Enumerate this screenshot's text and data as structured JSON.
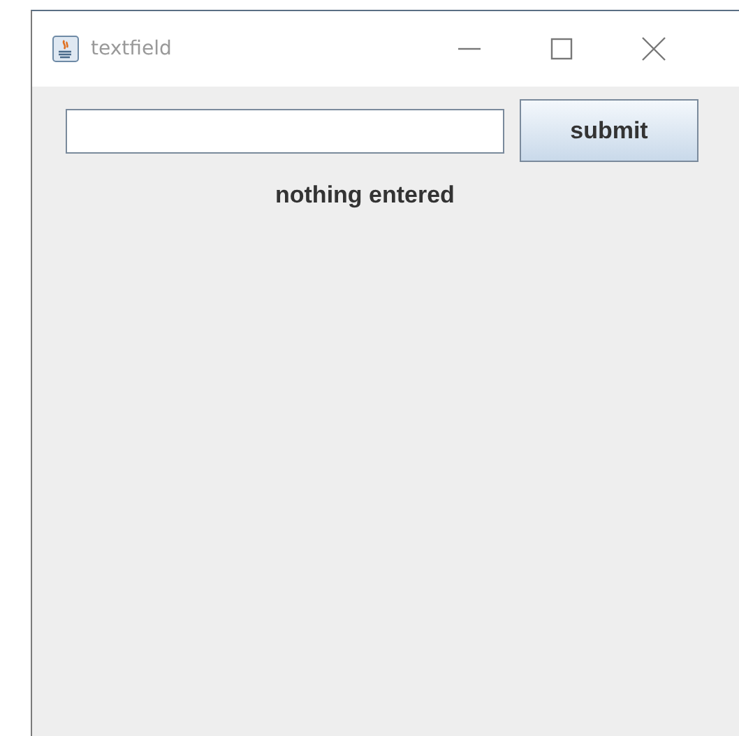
{
  "window": {
    "title": "textfield"
  },
  "button": {
    "label": "submit"
  },
  "status": {
    "text": "nothing entered"
  }
}
